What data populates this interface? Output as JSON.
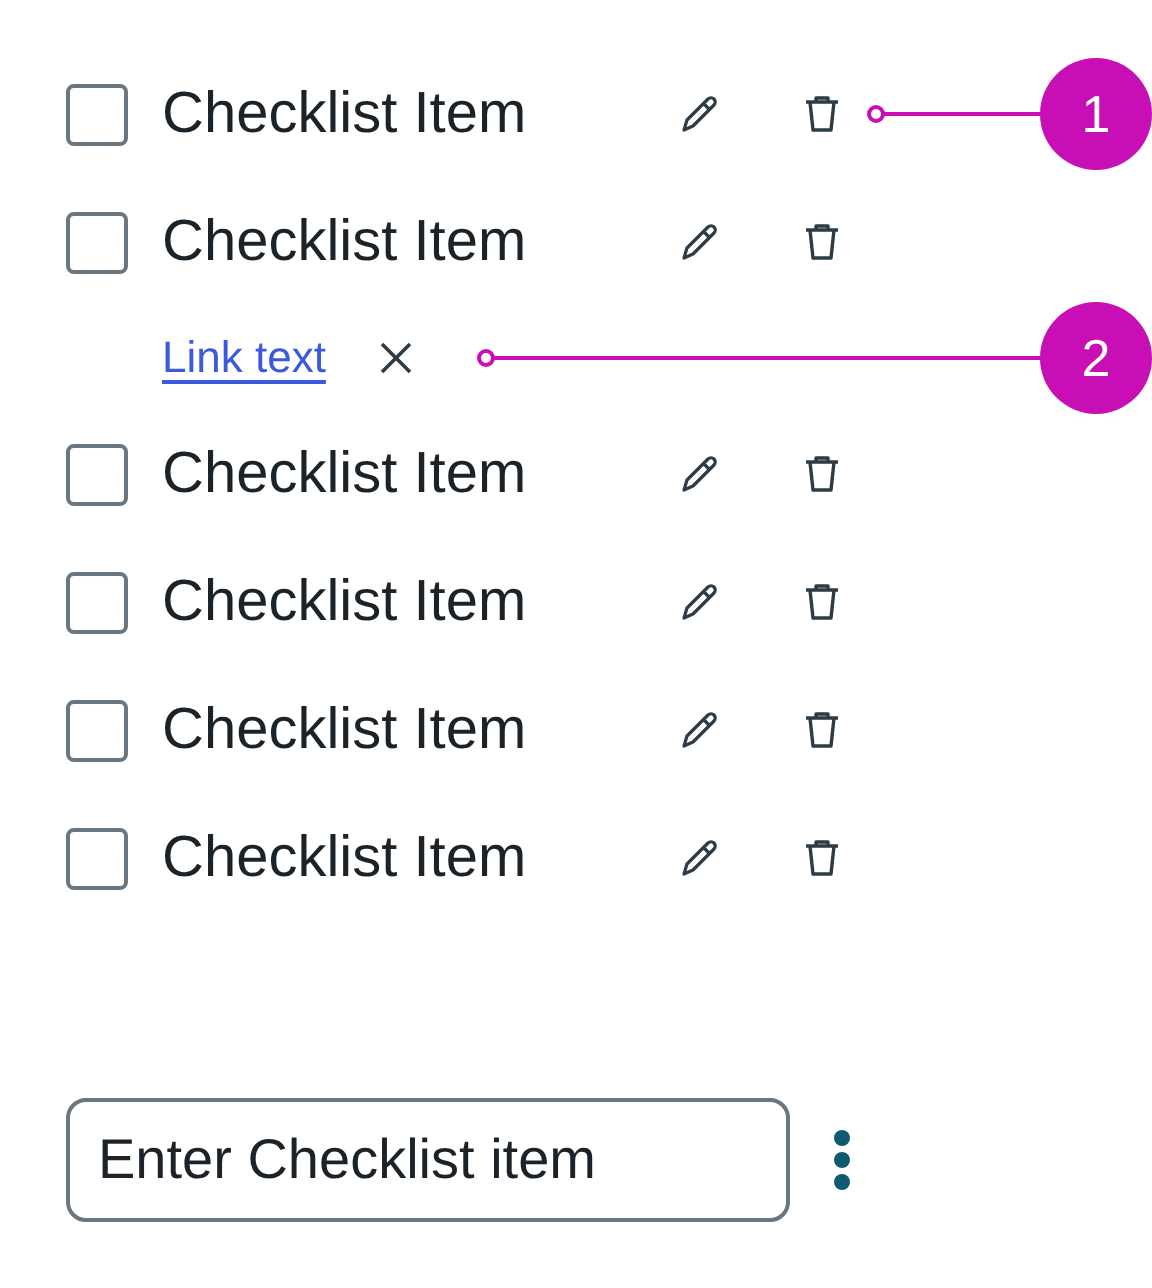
{
  "items": [
    {
      "kind": "item",
      "label": "Checklist Item",
      "checked": false,
      "callout": "1"
    },
    {
      "kind": "item",
      "label": "Checklist Item",
      "checked": false
    },
    {
      "kind": "link",
      "label": "Link text",
      "callout": "2"
    },
    {
      "kind": "item",
      "label": "Checklist Item",
      "checked": false
    },
    {
      "kind": "item",
      "label": "Checklist Item",
      "checked": false
    },
    {
      "kind": "item",
      "label": "Checklist Item",
      "checked": false
    },
    {
      "kind": "item",
      "label": "Checklist Item",
      "checked": false
    }
  ],
  "new_item": {
    "value": "Enter Checklist item"
  }
}
